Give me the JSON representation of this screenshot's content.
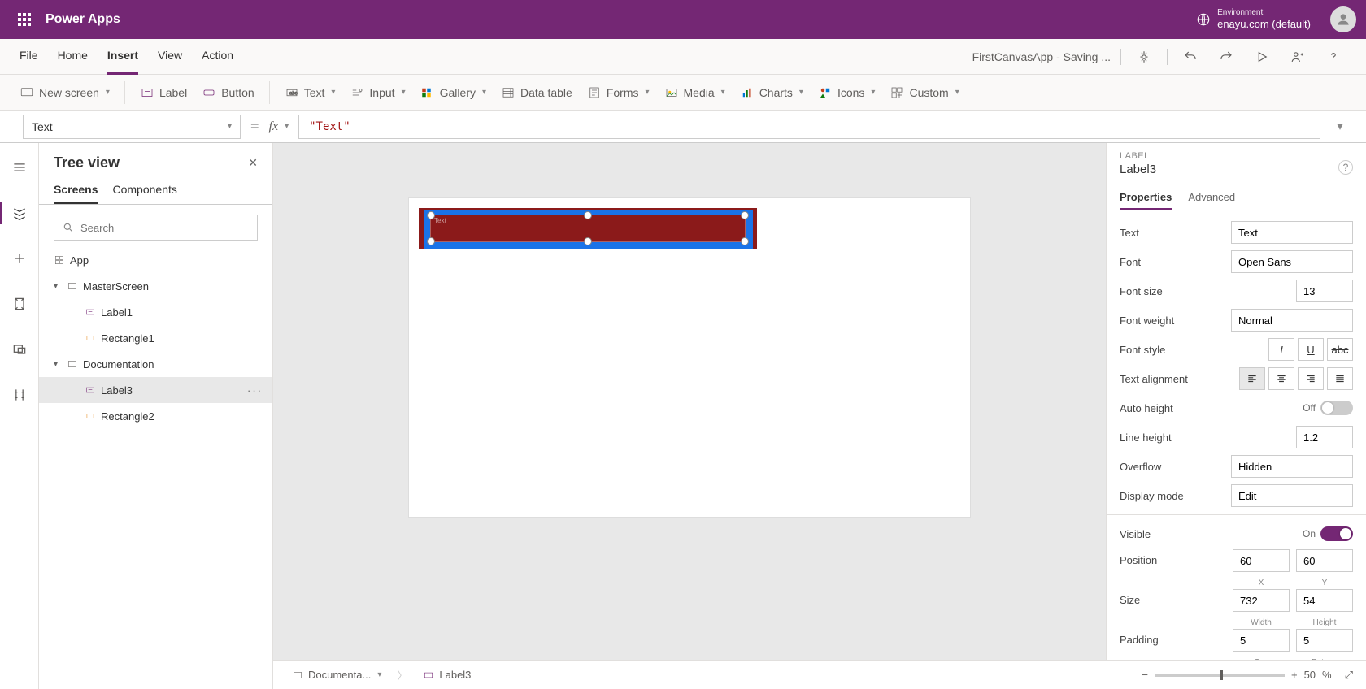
{
  "header": {
    "app_title": "Power Apps",
    "env_label": "Environment",
    "env_name": "enayu.com (default)"
  },
  "menu": {
    "tabs": [
      "File",
      "Home",
      "Insert",
      "View",
      "Action"
    ],
    "active_tab": "Insert",
    "doc_status": "FirstCanvasApp - Saving ..."
  },
  "ribbon": {
    "new_screen": "New screen",
    "label": "Label",
    "button": "Button",
    "text": "Text",
    "input": "Input",
    "gallery": "Gallery",
    "data_table": "Data table",
    "forms": "Forms",
    "media": "Media",
    "charts": "Charts",
    "icons": "Icons",
    "custom": "Custom"
  },
  "formula": {
    "property": "Text",
    "value": "\"Text\""
  },
  "tree": {
    "title": "Tree view",
    "tabs": [
      "Screens",
      "Components"
    ],
    "active_tab": "Screens",
    "search_placeholder": "Search",
    "items": [
      {
        "label": "App",
        "type": "app"
      },
      {
        "label": "MasterScreen",
        "type": "screen"
      },
      {
        "label": "Label1",
        "type": "label"
      },
      {
        "label": "Rectangle1",
        "type": "rect"
      },
      {
        "label": "Documentation",
        "type": "screen"
      },
      {
        "label": "Label3",
        "type": "label",
        "selected": true
      },
      {
        "label": "Rectangle2",
        "type": "rect"
      }
    ]
  },
  "canvas": {
    "label_text": "Text"
  },
  "status": {
    "screen": "Documenta...",
    "selected": "Label3",
    "zoom": "50",
    "pct": "%"
  },
  "props": {
    "type": "LABEL",
    "name": "Label3",
    "tabs": [
      "Properties",
      "Advanced"
    ],
    "text": {
      "label": "Text",
      "value": "Text"
    },
    "font": {
      "label": "Font",
      "value": "Open Sans"
    },
    "font_size": {
      "label": "Font size",
      "value": "13"
    },
    "font_weight": {
      "label": "Font weight",
      "value": "Normal"
    },
    "font_style": {
      "label": "Font style"
    },
    "text_align": {
      "label": "Text alignment"
    },
    "auto_height": {
      "label": "Auto height",
      "state": "Off"
    },
    "line_height": {
      "label": "Line height",
      "value": "1.2"
    },
    "overflow": {
      "label": "Overflow",
      "value": "Hidden"
    },
    "display_mode": {
      "label": "Display mode",
      "value": "Edit"
    },
    "visible": {
      "label": "Visible",
      "state": "On"
    },
    "position": {
      "label": "Position",
      "x": "60",
      "y": "60",
      "xl": "X",
      "yl": "Y"
    },
    "size": {
      "label": "Size",
      "w": "732",
      "h": "54",
      "wl": "Width",
      "hl": "Height"
    },
    "padding": {
      "label": "Padding",
      "t": "5",
      "b": "5",
      "tl": "Top",
      "bl": "Bottom"
    }
  }
}
